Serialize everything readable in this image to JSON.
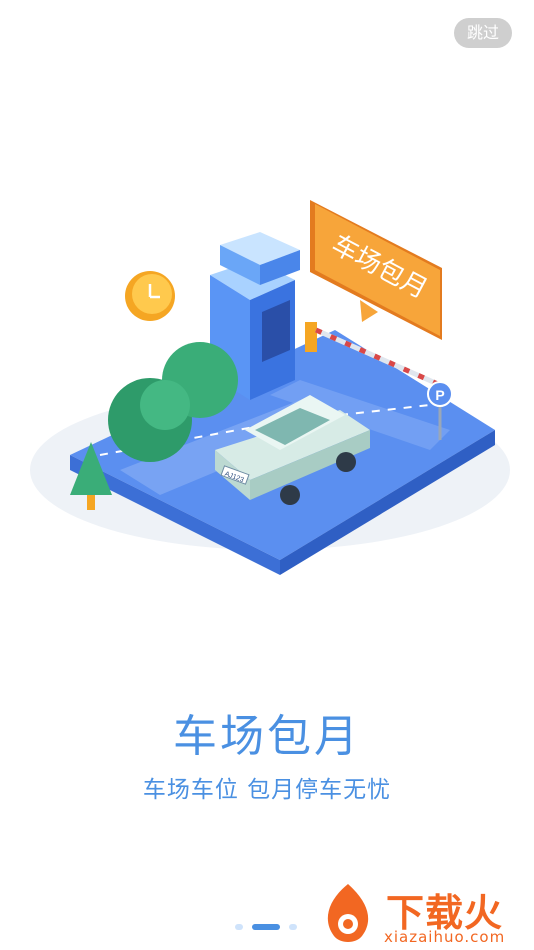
{
  "skip_label": "跳过",
  "illustration": {
    "bubble_text": "车场包月",
    "plate_text": "AJ123"
  },
  "title": "车场包月",
  "subtitle": "车场车位  包月停车无忧",
  "pagination": {
    "total": 3,
    "active_index": 1
  },
  "watermark": {
    "name": "下载火",
    "url": "xiazaihuo.com"
  },
  "colors": {
    "accent": "#4a90e2",
    "orange": "#f5a623",
    "green": "#2e8b57"
  }
}
